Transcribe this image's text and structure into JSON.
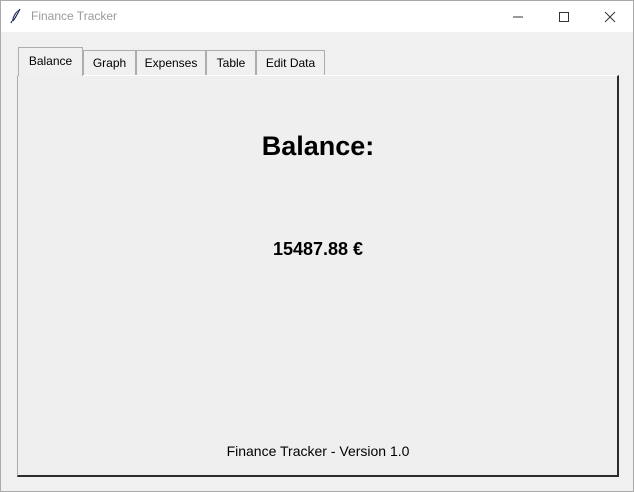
{
  "window": {
    "title": "Finance Tracker",
    "icon": "feather-icon"
  },
  "tabs": [
    {
      "label": "Balance",
      "active": true
    },
    {
      "label": "Graph",
      "active": false
    },
    {
      "label": "Expenses",
      "active": false
    },
    {
      "label": "Table",
      "active": false
    },
    {
      "label": "Edit Data",
      "active": false
    }
  ],
  "balance": {
    "heading": "Balance:",
    "value": "15487.88 €"
  },
  "footer": {
    "text": "Finance Tracker - Version 1.0"
  }
}
